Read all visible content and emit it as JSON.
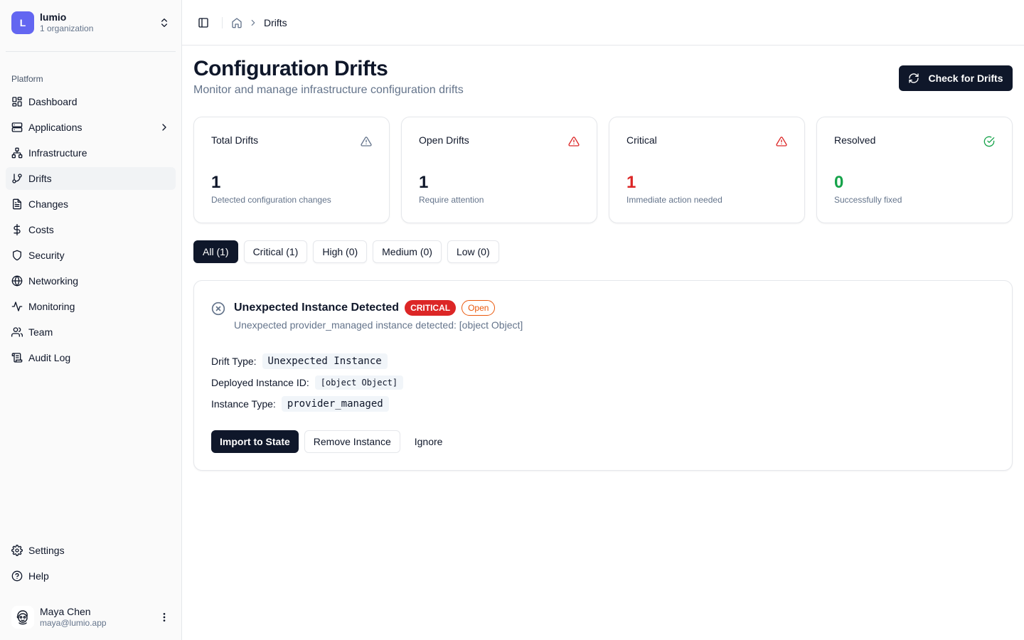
{
  "org": {
    "logo_letter": "L",
    "name": "lumio",
    "subtitle": "1 organization"
  },
  "sidebar": {
    "section_label": "Platform",
    "items": [
      {
        "label": "Dashboard",
        "icon": "layout-grid-icon"
      },
      {
        "label": "Applications",
        "icon": "server-icon"
      },
      {
        "label": "Infrastructure",
        "icon": "network-icon"
      },
      {
        "label": "Drifts",
        "icon": "git-branch-icon"
      },
      {
        "label": "Changes",
        "icon": "file-text-icon"
      },
      {
        "label": "Costs",
        "icon": "dollar-icon"
      },
      {
        "label": "Security",
        "icon": "shield-icon"
      },
      {
        "label": "Networking",
        "icon": "globe-icon"
      },
      {
        "label": "Monitoring",
        "icon": "activity-icon"
      },
      {
        "label": "Team",
        "icon": "users-icon"
      },
      {
        "label": "Audit Log",
        "icon": "scroll-icon"
      }
    ],
    "bottom_items": [
      {
        "label": "Settings",
        "icon": "gear-icon"
      },
      {
        "label": "Help",
        "icon": "help-circle-icon"
      }
    ]
  },
  "user": {
    "name": "Maya Chen",
    "email": "maya@lumio.app"
  },
  "breadcrumb": {
    "current": "Drifts"
  },
  "header": {
    "title": "Configuration Drifts",
    "subtitle": "Monitor and manage infrastructure configuration drifts",
    "action_label": "Check for Drifts"
  },
  "stats": [
    {
      "title": "Total Drifts",
      "value": "1",
      "desc": "Detected configuration changes",
      "color": "#0f172a",
      "icon_color": "#64748b"
    },
    {
      "title": "Open Drifts",
      "value": "1",
      "desc": "Require attention",
      "color": "#0f172a",
      "icon_color": "#dc2626"
    },
    {
      "title": "Critical",
      "value": "1",
      "desc": "Immediate action needed",
      "color": "#dc2626",
      "icon_color": "#dc2626"
    },
    {
      "title": "Resolved",
      "value": "0",
      "desc": "Successfully fixed",
      "color": "#16a34a",
      "icon_color": "#16a34a"
    }
  ],
  "filters": [
    {
      "label": "All (1)",
      "active": true
    },
    {
      "label": "Critical (1)",
      "active": false
    },
    {
      "label": "High (0)",
      "active": false
    },
    {
      "label": "Medium (0)",
      "active": false
    },
    {
      "label": "Low (0)",
      "active": false
    }
  ],
  "drift": {
    "title": "Unexpected Instance Detected",
    "severity": "CRITICAL",
    "status": "Open",
    "description": "Unexpected provider_managed instance detected: [object Object]",
    "fields": [
      {
        "label": "Drift Type:",
        "value": "Unexpected Instance"
      },
      {
        "label": "Deployed Instance ID:",
        "value": "[object Object]"
      },
      {
        "label": "Instance Type:",
        "value": "provider_managed"
      }
    ],
    "actions": {
      "import": "Import to State",
      "remove": "Remove Instance",
      "ignore": "Ignore"
    }
  }
}
